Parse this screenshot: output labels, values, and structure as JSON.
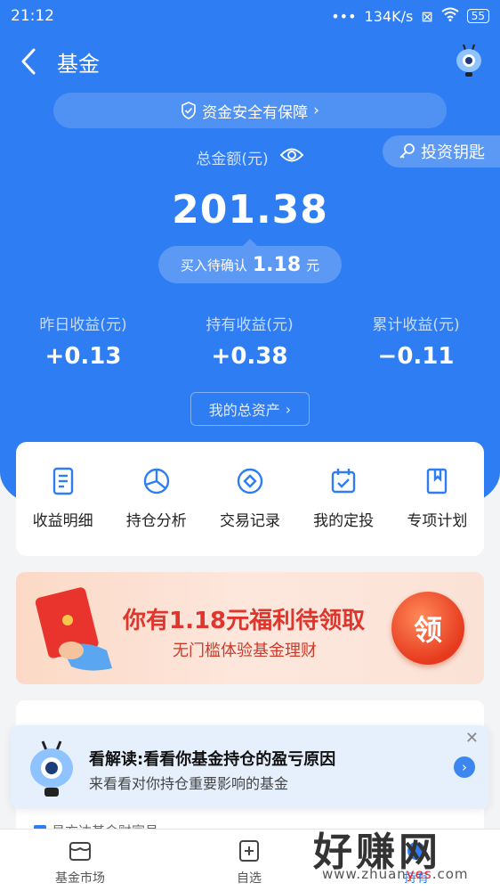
{
  "status_bar": {
    "time": "21:12",
    "network_speed": "134K/s",
    "battery": "55"
  },
  "nav": {
    "title": "基金"
  },
  "safety_banner": {
    "label": "资金安全有保障"
  },
  "key_button": {
    "label": "投资钥匙"
  },
  "summary": {
    "total_label": "总金额(元)",
    "total_amount": "201.38",
    "pending_prefix": "买入待确认",
    "pending_amount": "1.18",
    "pending_unit": "元"
  },
  "stats": [
    {
      "label": "昨日收益(元)",
      "value": "+0.13"
    },
    {
      "label": "持有收益(元)",
      "value": "+0.38"
    },
    {
      "label": "累计收益(元)",
      "value": "−0.11"
    }
  ],
  "assets_button": {
    "label": "我的总资产"
  },
  "menu": [
    {
      "label": "收益明细",
      "icon": "document-icon"
    },
    {
      "label": "持仓分析",
      "icon": "pie-chart-icon"
    },
    {
      "label": "交易记录",
      "icon": "diamond-circle-icon"
    },
    {
      "label": "我的定投",
      "icon": "calendar-check-icon"
    },
    {
      "label": "专项计划",
      "icon": "bookmark-icon"
    }
  ],
  "promo": {
    "title": "你有1.18元福利待领取",
    "subtitle": "无门槛体验基金理财",
    "button": "领"
  },
  "hidden_card": {
    "row_text": "易方达基金财富号"
  },
  "popup": {
    "title": "看解读:看看你基金持仓的盈亏原因",
    "subtitle": "来看看对你持仓重要影响的基金"
  },
  "tabbar": [
    {
      "label": "基金市场"
    },
    {
      "label": "自选"
    },
    {
      "label": "持有"
    }
  ],
  "watermark": {
    "text": "好赚网",
    "url_prefix": "www.zhuan",
    "url_highlight": "yes",
    "url_suffix": ".com"
  },
  "colors": {
    "primary": "#2f7df2",
    "promo_red": "#e0352c",
    "background": "#f3f4f6"
  }
}
